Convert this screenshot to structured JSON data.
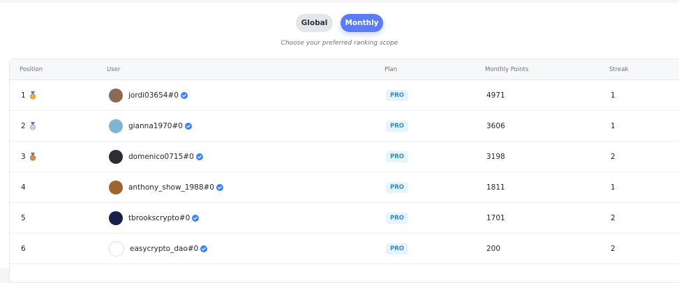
{
  "scope": {
    "options": [
      "Global",
      "Monthly"
    ],
    "selected": "Monthly",
    "hint": "Choose your preferred ranking scope"
  },
  "table": {
    "headers": {
      "position": "Position",
      "user": "User",
      "plan": "Plan",
      "points": "Monthly Points",
      "streak": "Streak"
    },
    "rows": [
      {
        "position": "1",
        "medal": "gold",
        "user": "jordi03654#0",
        "plan": "PRO",
        "points": "4971",
        "streak": "1",
        "avatar_color": "#8a6a55"
      },
      {
        "position": "2",
        "medal": "silver",
        "user": "gianna1970#0",
        "plan": "PRO",
        "points": "3606",
        "streak": "1",
        "avatar_color": "#7fb6cf"
      },
      {
        "position": "3",
        "medal": "bronze",
        "user": "domenico0715#0",
        "plan": "PRO",
        "points": "3198",
        "streak": "2",
        "avatar_color": "#2b2f33"
      },
      {
        "position": "4",
        "medal": "",
        "user": "anthony_show_1988#0",
        "plan": "PRO",
        "points": "1811",
        "streak": "1",
        "avatar_color": "#a0652e"
      },
      {
        "position": "5",
        "medal": "",
        "user": "tbrookscrypto#0",
        "plan": "PRO",
        "points": "1701",
        "streak": "2",
        "avatar_color": "#1b1d4a"
      },
      {
        "position": "6",
        "medal": "",
        "user": "easycrypto_dao#0",
        "plan": "PRO",
        "points": "200",
        "streak": "2",
        "avatar_color": "#ffffff"
      }
    ]
  },
  "colors": {
    "accent": "#5b7cf5",
    "verified": "#3b82f6",
    "pro_text": "#2f8fc4",
    "pro_bg": "#e8f4fb"
  },
  "icons": {
    "verified": "verified-check-icon",
    "medals": [
      "gold-medal-icon",
      "silver-medal-icon",
      "bronze-medal-icon"
    ]
  }
}
